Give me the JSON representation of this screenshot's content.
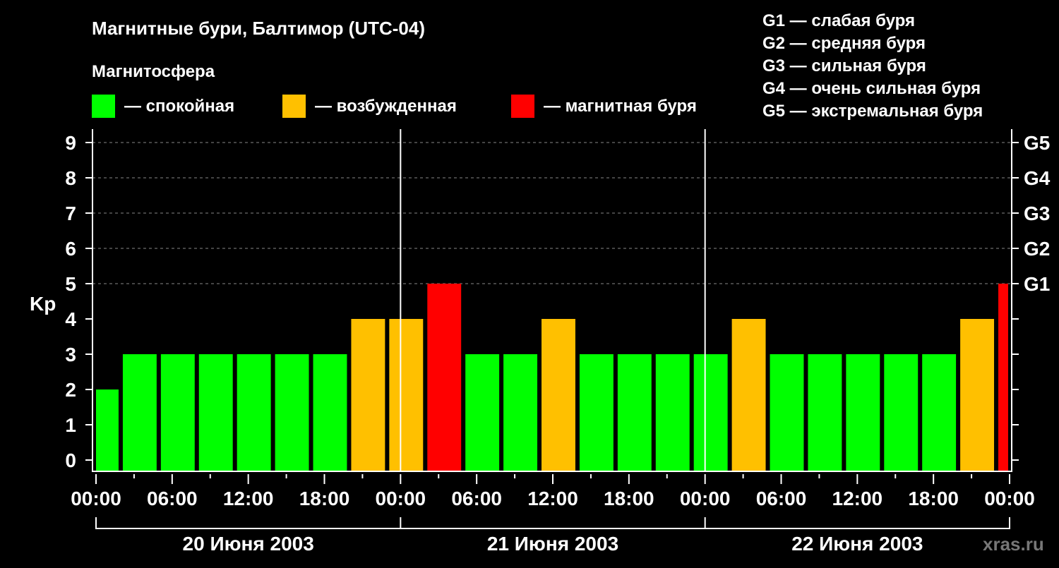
{
  "chart_data": {
    "type": "bar",
    "title": "Магнитные бури, Балтимор (UTC-04)",
    "legend_title": "Магнитосфера",
    "legend": [
      {
        "label": "— спокойная",
        "color": "#00ff00"
      },
      {
        "label": "— возбужденная",
        "color": "#ffc000"
      },
      {
        "label": "— магнитная буря",
        "color": "#ff0000"
      }
    ],
    "g_scale": [
      "G1 — слабая буря",
      "G2 — средняя буря",
      "G3 — сильная буря",
      "G4 — очень сильная буря",
      "G5 — экстремальная буря"
    ],
    "ylabel": "Kp",
    "ylim": [
      0,
      9
    ],
    "yticks": [
      0,
      1,
      2,
      3,
      4,
      5,
      6,
      7,
      8,
      9
    ],
    "right_ticks": [
      {
        "v": 5,
        "label": "G1"
      },
      {
        "v": 6,
        "label": "G2"
      },
      {
        "v": 7,
        "label": "G3"
      },
      {
        "v": 8,
        "label": "G4"
      },
      {
        "v": 9,
        "label": "G5"
      }
    ],
    "x_hours_range": [
      0,
      72
    ],
    "xticks": [
      {
        "h": 0,
        "label": "00:00"
      },
      {
        "h": 6,
        "label": "06:00"
      },
      {
        "h": 12,
        "label": "12:00"
      },
      {
        "h": 18,
        "label": "18:00"
      },
      {
        "h": 24,
        "label": "00:00"
      },
      {
        "h": 30,
        "label": "06:00"
      },
      {
        "h": 36,
        "label": "12:00"
      },
      {
        "h": 42,
        "label": "18:00"
      },
      {
        "h": 48,
        "label": "00:00"
      },
      {
        "h": 54,
        "label": "06:00"
      },
      {
        "h": 60,
        "label": "12:00"
      },
      {
        "h": 66,
        "label": "18:00"
      },
      {
        "h": 72,
        "label": "00:00"
      }
    ],
    "days": [
      "20 Июня 2003",
      "21 Июня 2003",
      "22 Июня 2003"
    ],
    "bars": [
      {
        "start": 0,
        "end": 2,
        "kp": 2
      },
      {
        "start": 2,
        "end": 5,
        "kp": 3
      },
      {
        "start": 5,
        "end": 8,
        "kp": 3
      },
      {
        "start": 8,
        "end": 11,
        "kp": 3
      },
      {
        "start": 11,
        "end": 14,
        "kp": 3
      },
      {
        "start": 14,
        "end": 17,
        "kp": 3
      },
      {
        "start": 17,
        "end": 20,
        "kp": 3
      },
      {
        "start": 20,
        "end": 23,
        "kp": 4
      },
      {
        "start": 23,
        "end": 26,
        "kp": 4
      },
      {
        "start": 26,
        "end": 29,
        "kp": 5
      },
      {
        "start": 29,
        "end": 32,
        "kp": 3
      },
      {
        "start": 32,
        "end": 35,
        "kp": 3
      },
      {
        "start": 35,
        "end": 38,
        "kp": 4
      },
      {
        "start": 38,
        "end": 41,
        "kp": 3
      },
      {
        "start": 41,
        "end": 44,
        "kp": 3
      },
      {
        "start": 44,
        "end": 47,
        "kp": 3
      },
      {
        "start": 47,
        "end": 50,
        "kp": 3
      },
      {
        "start": 50,
        "end": 53,
        "kp": 4
      },
      {
        "start": 53,
        "end": 56,
        "kp": 3
      },
      {
        "start": 56,
        "end": 59,
        "kp": 3
      },
      {
        "start": 59,
        "end": 62,
        "kp": 3
      },
      {
        "start": 62,
        "end": 65,
        "kp": 3
      },
      {
        "start": 65,
        "end": 68,
        "kp": 3
      },
      {
        "start": 68,
        "end": 71,
        "kp": 4
      },
      {
        "start": 71,
        "end": 72,
        "kp": 5
      }
    ],
    "grid": "dashed at Kp 5-9",
    "watermark": "xras.ru"
  }
}
